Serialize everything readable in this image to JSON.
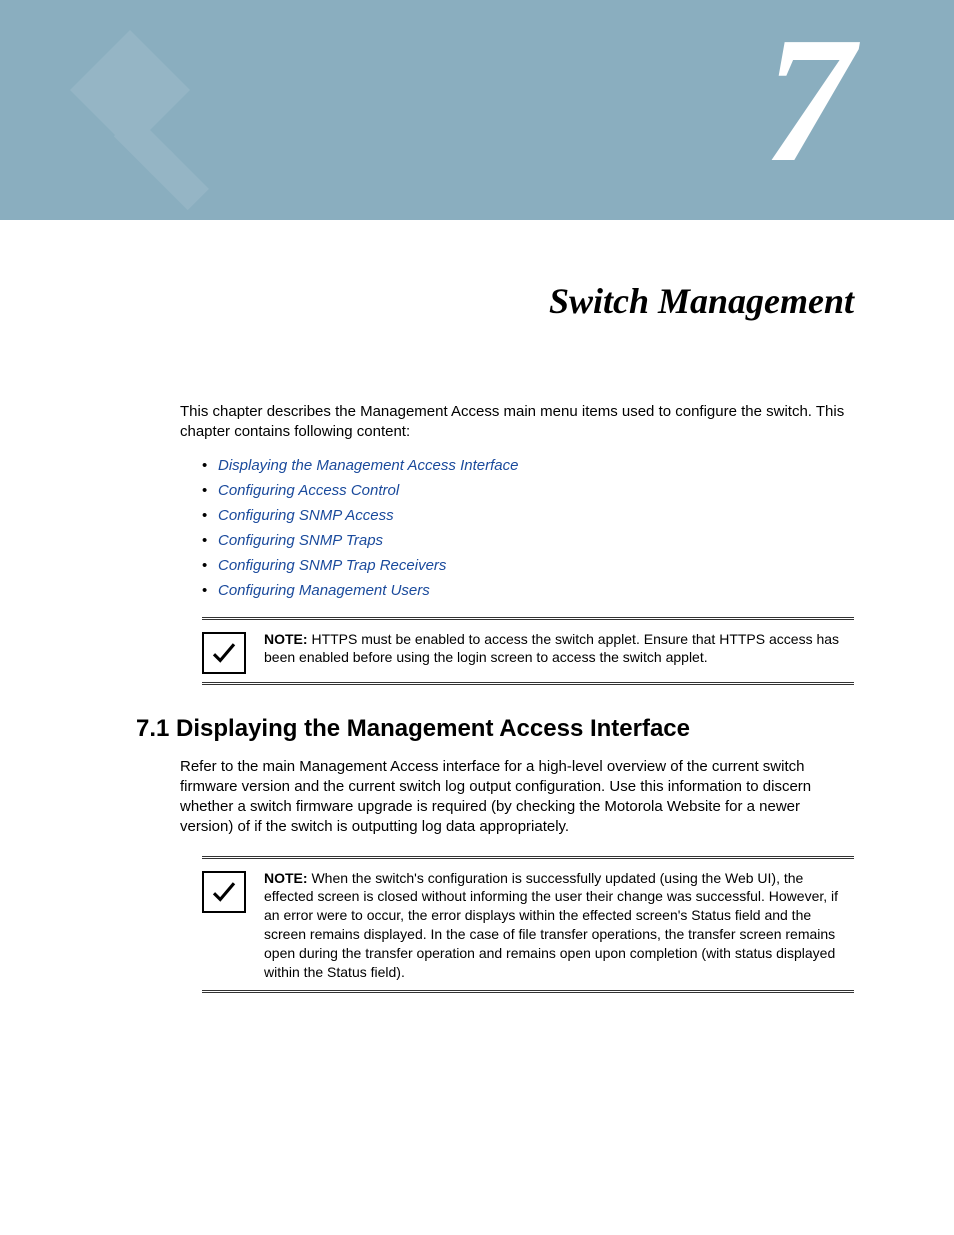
{
  "chapter": {
    "number": "7",
    "title": "Switch Management"
  },
  "intro": "This chapter describes the Management Access main menu items used to configure the switch. This chapter contains following content:",
  "links": [
    "Displaying the Management Access Interface",
    "Configuring Access Control",
    "Configuring SNMP Access",
    "Configuring SNMP Traps",
    "Configuring SNMP Trap Receivers",
    "Configuring Management Users"
  ],
  "note1": {
    "label": "NOTE:",
    "text": " HTTPS must be enabled to access the switch applet. Ensure that HTTPS access has been enabled before using the login screen to access the switch applet."
  },
  "section": {
    "number": "7.1",
    "title": "Displaying the Management Access Interface",
    "body": "Refer to the main Management Access interface for a high-level overview of the current switch firmware version and the current switch log output configuration. Use this information to discern whether a switch firmware upgrade is required (by checking the Motorola Website for a newer version) of if the switch is outputting log data appropriately."
  },
  "note2": {
    "label": "NOTE:",
    "text": " When the switch's configuration is successfully updated (using the Web UI), the effected screen is closed without informing the user their change was successful. However, if an error were to occur, the error displays within the effected screen's Status field and the screen remains displayed. In the case of file transfer operations, the transfer screen remains open during the transfer operation and remains open upon completion (with status displayed within the Status field)."
  }
}
